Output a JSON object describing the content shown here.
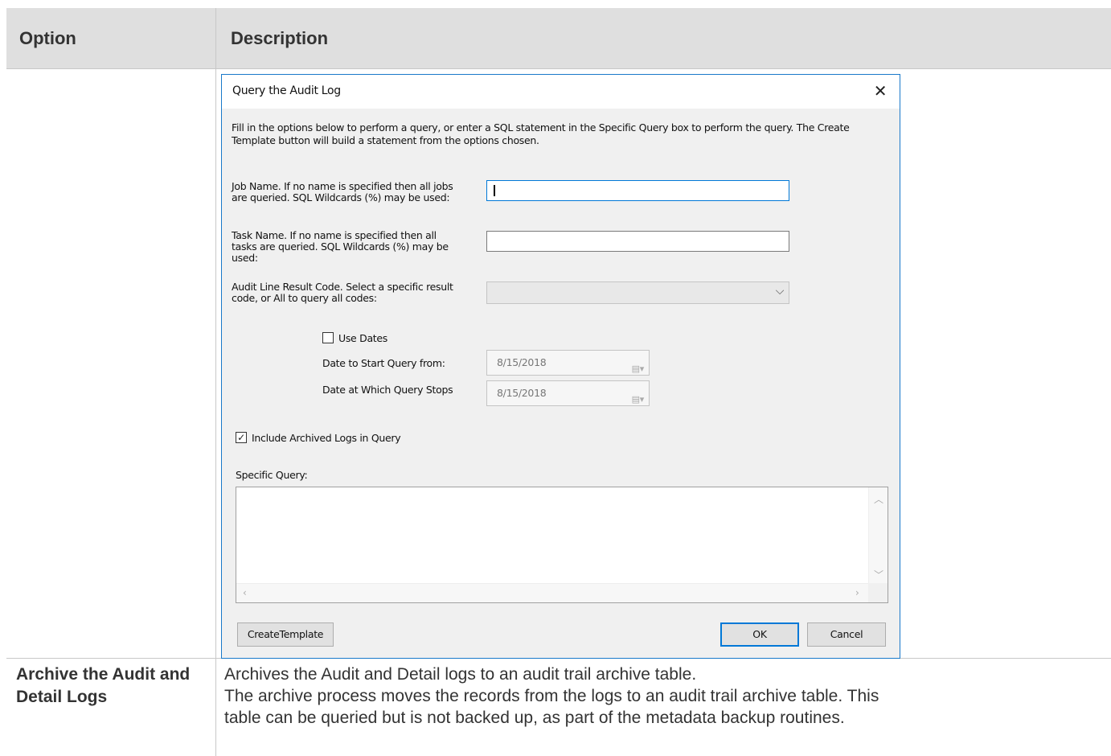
{
  "table": {
    "headers": {
      "option": "Option",
      "description": "Description"
    },
    "row2": {
      "option": "Archive the Audit and Detail Logs",
      "description_lines": [
        "Archives the Audit and Detail logs to an audit trail archive table.",
        "The archive process moves the records from the logs to an audit trail archive table. This",
        "table can be queried but is not backed up, as part of the metadata backup routines."
      ]
    }
  },
  "dialog": {
    "title": "Query the Audit Log",
    "close_glyph": "✕",
    "instructions": "Fill in the options below to perform a query, or enter a SQL statement in the Specific Query box to perform the query. The Create Template button will build a statement from the options chosen.",
    "job_name_label": "Job Name. If no name is specified then all jobs are queried. SQL Wildcards (%) may be used:",
    "job_name_value": "",
    "task_name_label": "Task Name. If no name is specified then all tasks are queried. SQL Wildcards (%) may be used:",
    "task_name_value": "",
    "result_code_label": "Audit Line Result Code.  Select a specific result code, or All to query all codes:",
    "result_code_value": "",
    "use_dates_label": "Use Dates",
    "use_dates_checked": false,
    "start_date_label": "Date to Start Query from:",
    "start_date_value": "8/15/2018",
    "stop_date_label": "Date at Which Query Stops",
    "stop_date_value": "8/15/2018",
    "include_archived_label": "Include Archived Logs in Query",
    "include_archived_checked": true,
    "check_glyph": "✓",
    "specific_query_label": "Specific Query:",
    "specific_query_value": "",
    "buttons": {
      "create_template": "CreateTemplate",
      "ok": "OK",
      "cancel": "Cancel"
    },
    "icons": {
      "chevron_down": "⌵",
      "calendar": "▤▾",
      "scroll_up": "︿",
      "scroll_down": "﹀",
      "scroll_left": "‹",
      "scroll_right": "›"
    },
    "colors": {
      "focus_border": "#0078d7",
      "dialog_border": "#1979ca",
      "header_bg": "#dfdfdf"
    }
  }
}
